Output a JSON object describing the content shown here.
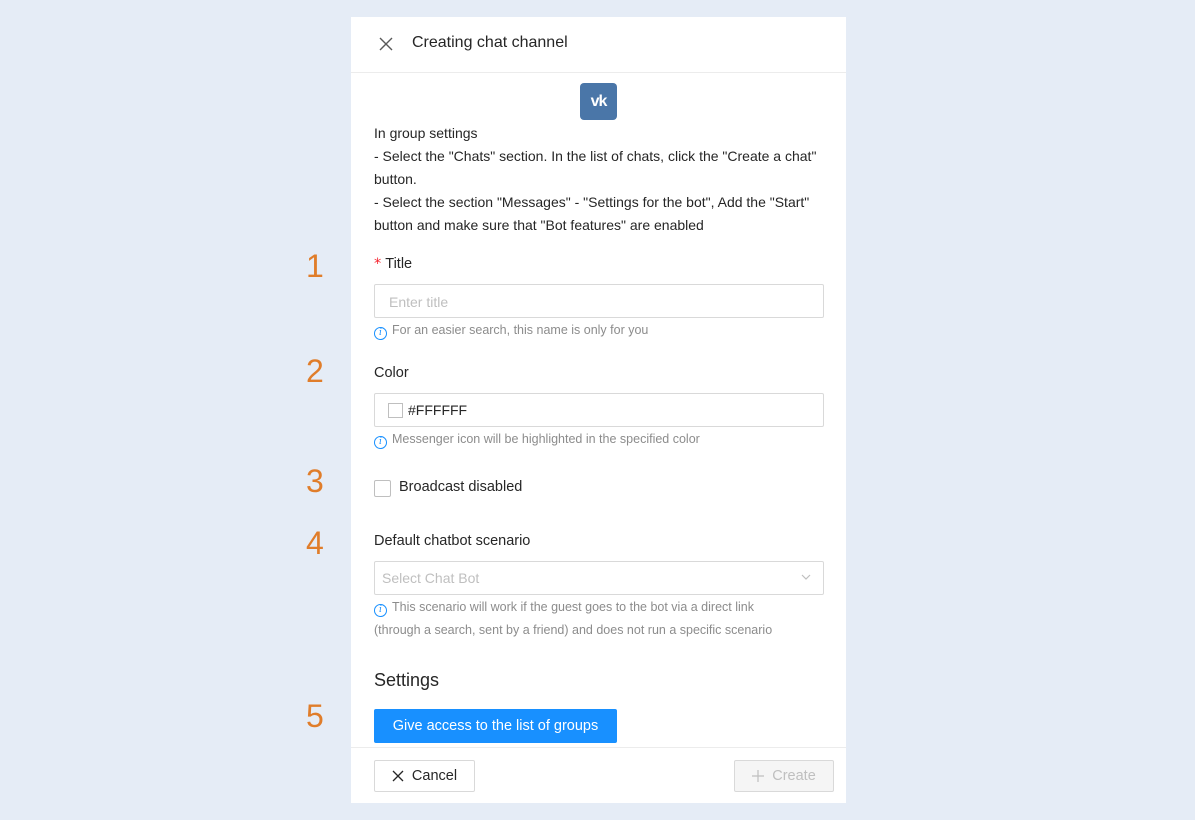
{
  "step_numbers": [
    "1",
    "2",
    "3",
    "4",
    "5"
  ],
  "header": {
    "title": "Creating chat channel"
  },
  "logo": {
    "text": "vk",
    "color": "#4a76a8"
  },
  "instructions": {
    "line1": "In group settings",
    "line2": "- Select the \"Chats\" section. In the list of chats, click the \"Create a chat\" button.",
    "line3": "- Select the section \"Messages\" - \"Settings for the bot\", Add the \"Start\" button and make sure that \"Bot features\" are enabled"
  },
  "title_field": {
    "required_mark": "*",
    "label": "Title",
    "placeholder": "Enter title",
    "value": "",
    "hint": "For an easier search, this name is only for you"
  },
  "color_field": {
    "label": "Color",
    "value": "#FFFFFF",
    "hint": "Messenger icon will be highlighted in the specified color"
  },
  "broadcast": {
    "label": "Broadcast disabled",
    "checked": false
  },
  "chatbot_field": {
    "label": "Default chatbot scenario",
    "placeholder": "Select Chat Bot",
    "hint_line1": "This scenario will work if the guest goes to the bot via a direct link",
    "hint_line2": "(through a search, sent by a friend) and does not run a specific scenario"
  },
  "settings": {
    "heading": "Settings",
    "groups_button": "Give access to the list of groups"
  },
  "footer": {
    "cancel_label": "Cancel",
    "create_label": "Create"
  },
  "colors": {
    "accent": "#1890ff",
    "step_number": "#e07d2a",
    "background": "#e5ecf6"
  }
}
